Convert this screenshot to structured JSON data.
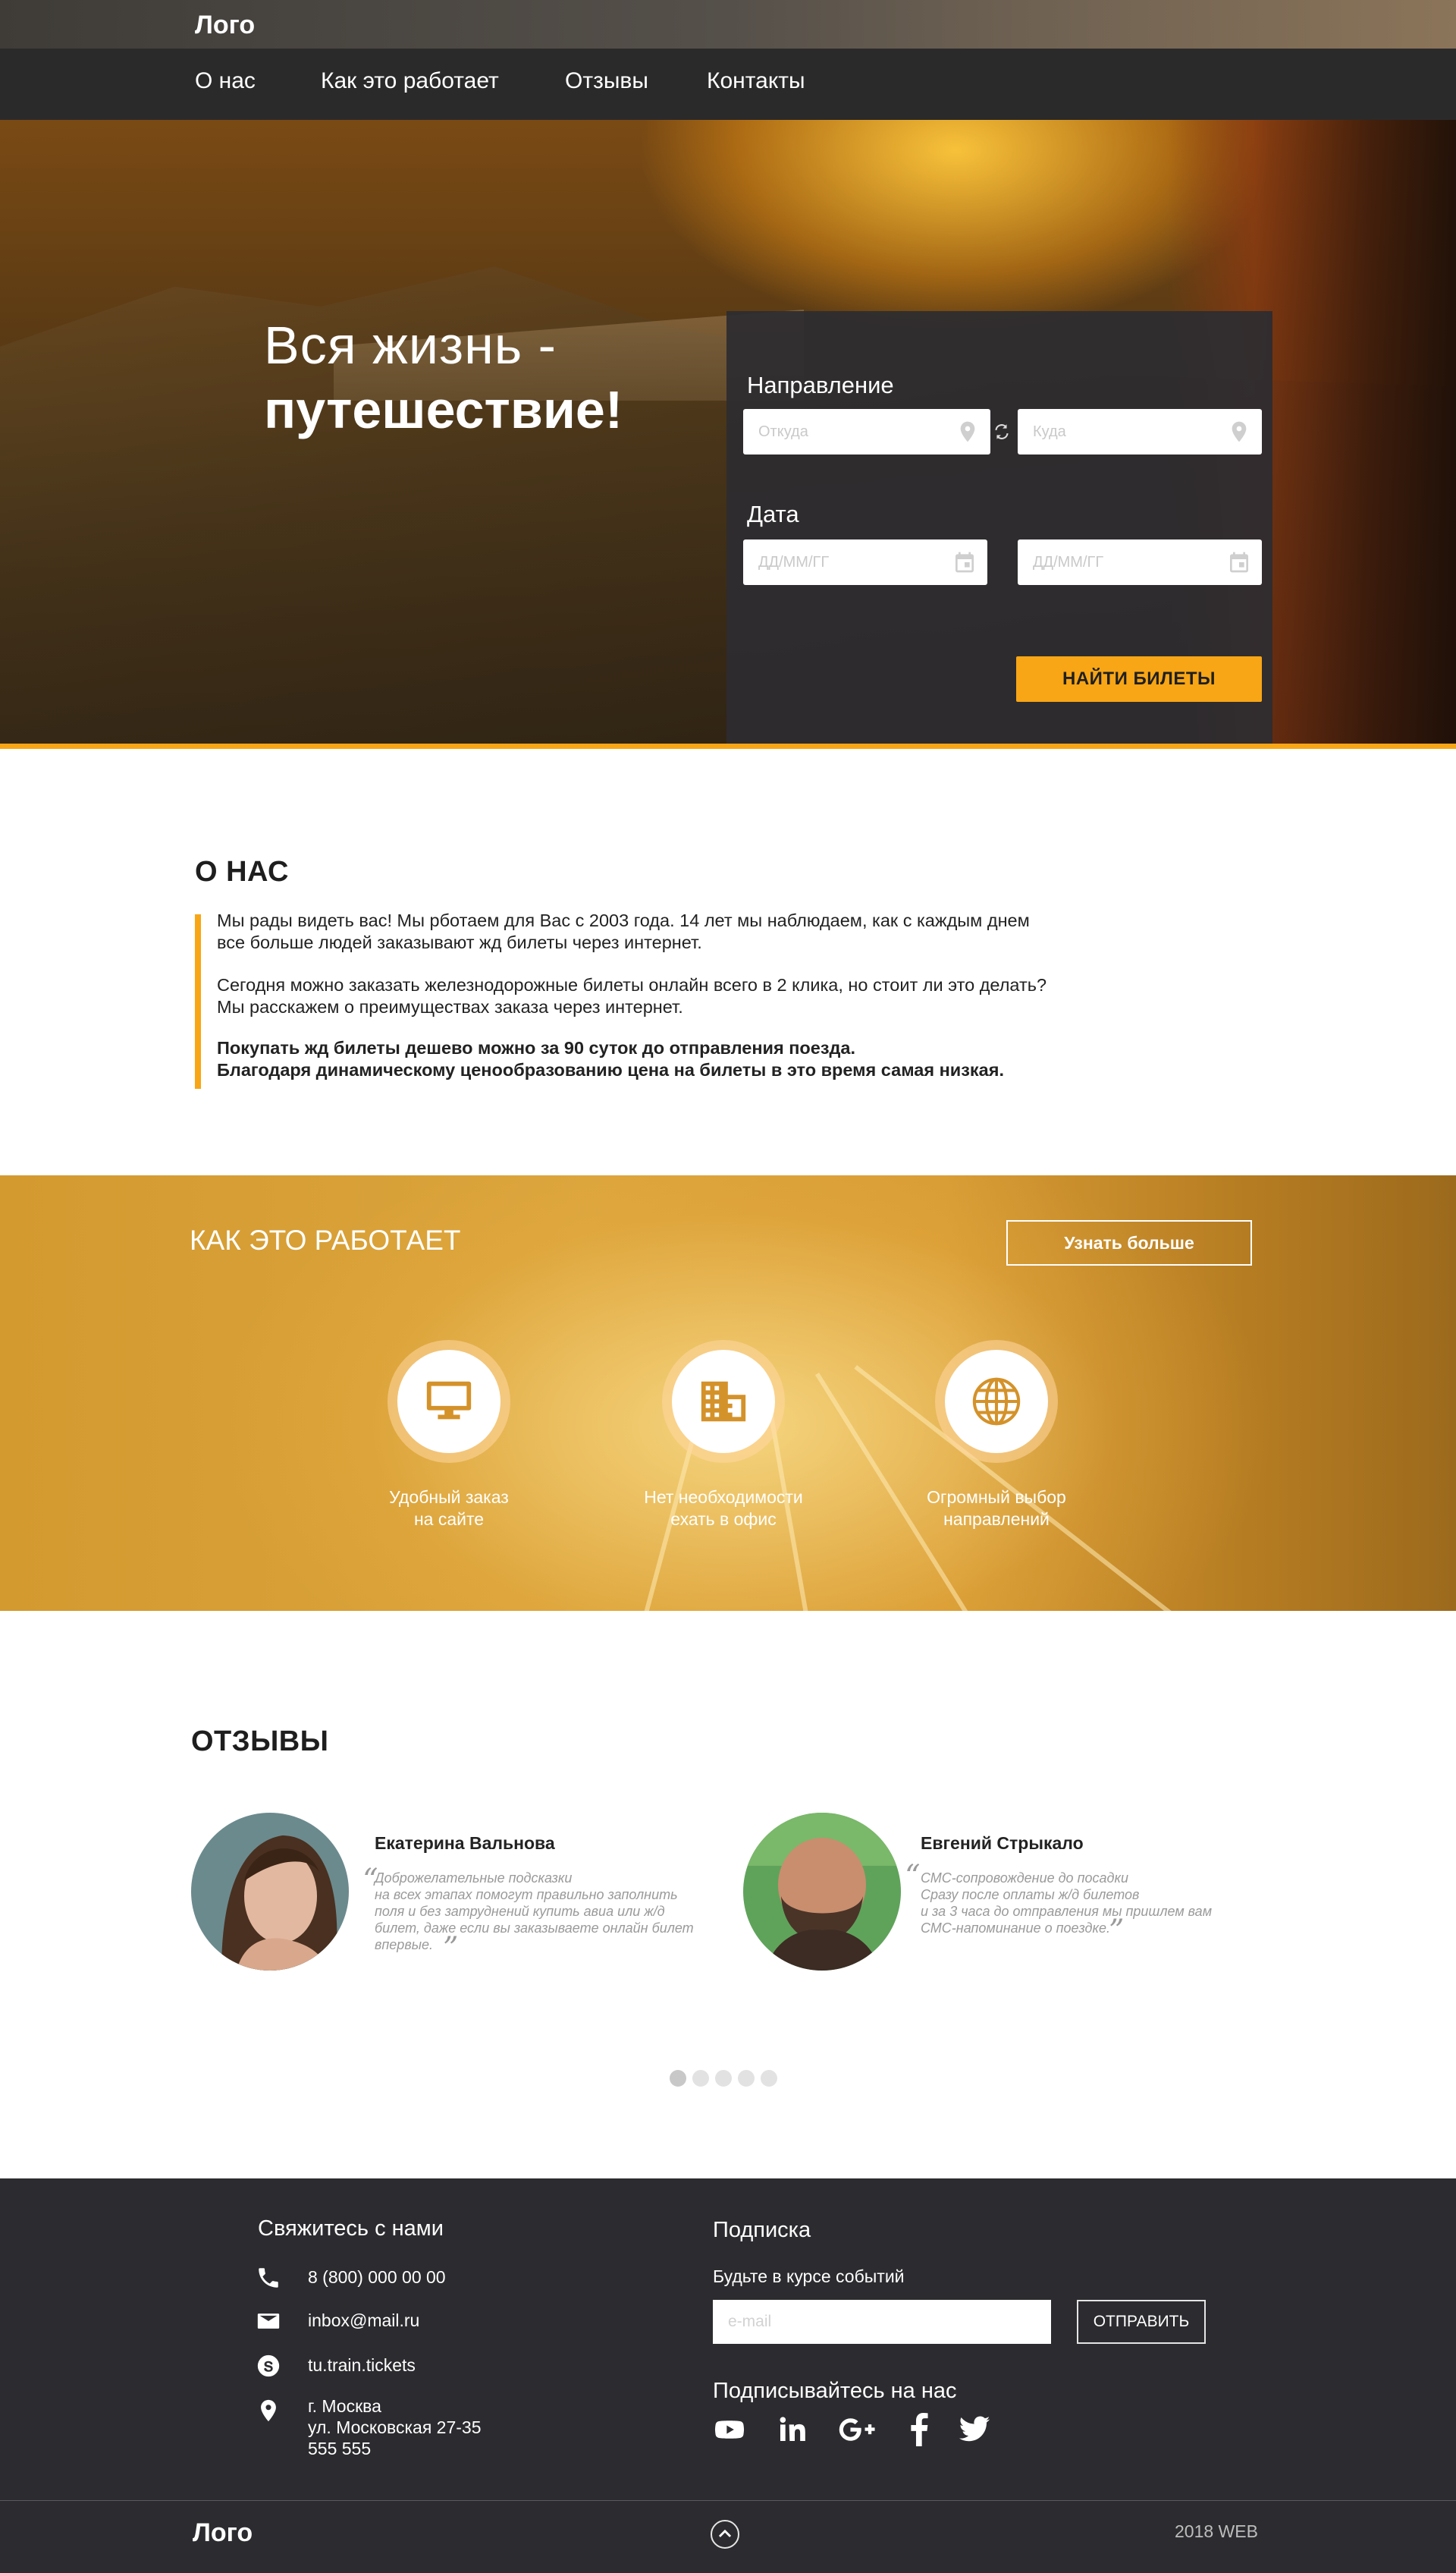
{
  "header": {
    "logo": "Лого",
    "nav": [
      "О нас",
      "Как это работает",
      "Отзывы",
      "Контакты"
    ]
  },
  "hero": {
    "title_line1": "Вся жизнь -",
    "title_line2": "путешествие!",
    "search": {
      "direction_label": "Направление",
      "from_placeholder": "Откуда",
      "to_placeholder": "Куда",
      "date_label": "Дата",
      "date_placeholder_1": "ДД/ММ/ГГ",
      "date_placeholder_2": "ДД/ММ/ГГ",
      "submit_label": "НАЙТИ БИЛЕТЫ"
    }
  },
  "about": {
    "title": "О НАС",
    "p1_l1": "Мы рады видеть вас! Мы рботаем для Вас с 2003 года. 14 лет мы наблюдаем, как с каждым днем",
    "p1_l2": "все больше людей заказывают жд билеты через интернет.",
    "p2_l1": "Сегодня можно заказать железнодорожные билеты онлайн всего в 2 клика, но стоит ли это делать?",
    "p2_l2": "Мы расскажем о преимуществах заказа через интернет.",
    "p3_l1": "Покупать жд билеты дешево можно за 90 суток до отправления поезда.",
    "p3_l2": "Благодаря динамическому ценообразованию цена на билеты в это время самая низкая."
  },
  "how": {
    "title": "КАК ЭТО РАБОТАЕТ",
    "more_label": "Узнать больше",
    "features": [
      {
        "icon": "monitor-icon",
        "line1": "Удобный заказ",
        "line2": "на сайте"
      },
      {
        "icon": "office-building-icon",
        "line1": "Нет необходимости",
        "line2": "ехать в офис"
      },
      {
        "icon": "globe-icon",
        "line1": "Огромный выбор",
        "line2": "направлений"
      }
    ]
  },
  "reviews": {
    "title": "ОТЗЫВЫ",
    "items": [
      {
        "name": "Екатерина Вальнова",
        "lines": [
          "Доброжелательные подсказки",
          "на всех этапах помогут правильно заполнить",
          "поля и без затруднений купить авиа или ж/д",
          "билет, даже если вы заказываете онлайн билет",
          "впервые."
        ]
      },
      {
        "name": "Евгений Стрыкало",
        "lines": [
          "СМС-сопровождение до посадки",
          "Сразу после оплаты ж/д билетов",
          "и за 3 часа до отправления мы пришлем вам",
          "СМС-напоминание о поездке."
        ]
      }
    ],
    "dots_count": 5,
    "active_dot": 0
  },
  "footer": {
    "contacts_title": "Свяжитесь с нами",
    "phone": "8 (800) 000 00 00",
    "email": "inbox@mail.ru",
    "skype": "tu.train.tickets",
    "address_l1": "г. Москва",
    "address_l2": "ул. Московская 27-35",
    "address_l3": "555 555",
    "subscribe_title": "Подписка",
    "subscribe_text": "Будьте в курсе событий",
    "email_placeholder": "e-mail",
    "send_label": "ОТПРАВИТЬ",
    "social_title": "Подписывайтесь на нас",
    "social": [
      "youtube-icon",
      "linkedin-icon",
      "google-plus-icon",
      "facebook-icon",
      "twitter-icon"
    ],
    "logo": "Лого",
    "copyright": "2018 WEB"
  },
  "colors": {
    "accent": "#f8a616",
    "dark": "#2c2b2f",
    "nav": "#2b2a2b"
  }
}
